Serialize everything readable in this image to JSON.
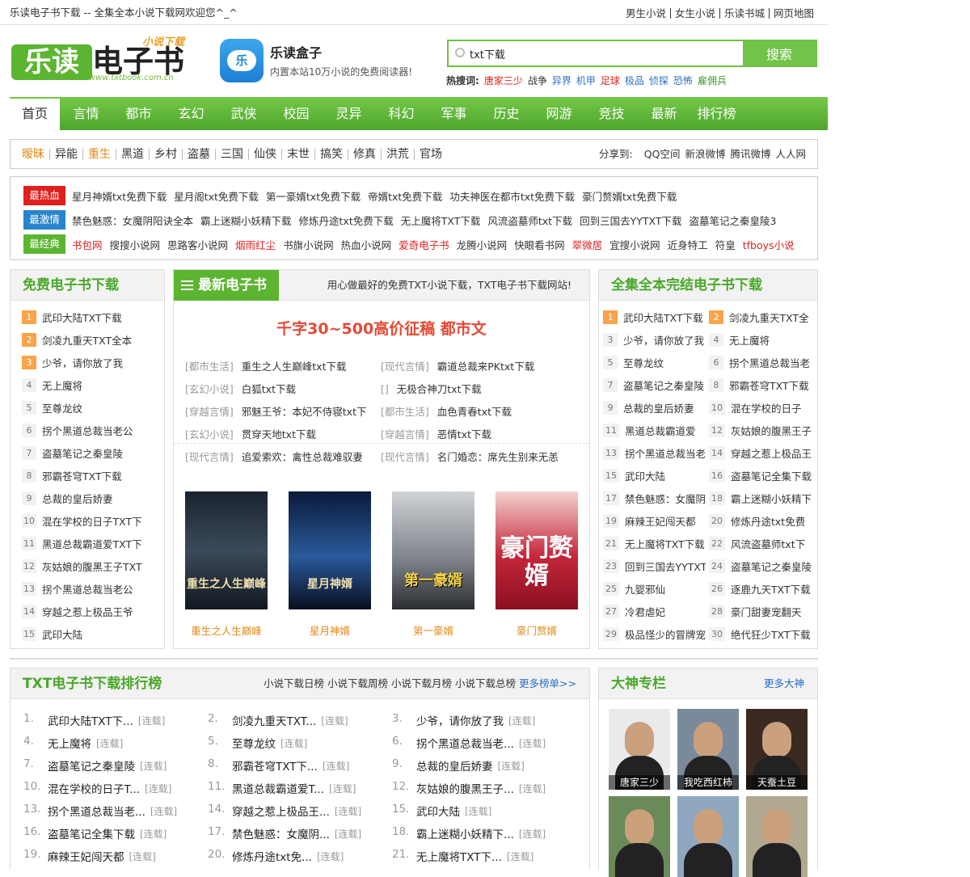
{
  "topbar": {
    "welcome": "乐读电子书下载 -- 全集全本小说下载网欢迎您^_^",
    "links": [
      "男生小说",
      "女生小说",
      "乐读书城",
      "网页地图"
    ]
  },
  "logo": {
    "main": "乐读",
    "main2": "电子书",
    "tag": "小说下载",
    "url": "www.txtbook.com.cn"
  },
  "app": {
    "icon_char": "乐",
    "name": "乐读盒子",
    "desc": "内置本站10万小说的免费阅读器!"
  },
  "search": {
    "value": "txt下载",
    "button": "搜索"
  },
  "hotwords": {
    "label": "热搜词:",
    "items": [
      {
        "text": "唐家三少",
        "color": "#e02020"
      },
      {
        "text": "战争",
        "color": "#333333"
      },
      {
        "text": "异界",
        "color": "#2a6ec7"
      },
      {
        "text": "机甲",
        "color": "#2a6ec7"
      },
      {
        "text": "足球",
        "color": "#e02020"
      },
      {
        "text": "极品",
        "color": "#2a6ec7"
      },
      {
        "text": "侦探",
        "color": "#2a6ec7"
      },
      {
        "text": "恐怖",
        "color": "#2a6ec7"
      },
      {
        "text": "雇佣兵",
        "color": "#3a9a2a"
      }
    ]
  },
  "nav": [
    "首页",
    "言情",
    "都市",
    "玄幻",
    "武侠",
    "校园",
    "灵异",
    "科幻",
    "军事",
    "历史",
    "网游",
    "竞技",
    "最新",
    "排行榜"
  ],
  "categories": [
    {
      "text": "暧昧",
      "color": "#e08a1a"
    },
    {
      "text": "异能",
      "color": "#333333"
    },
    {
      "text": "重生",
      "color": "#e08a1a"
    },
    {
      "text": "黑道",
      "color": "#333333"
    },
    {
      "text": "乡村",
      "color": "#333333"
    },
    {
      "text": "盗墓",
      "color": "#333333"
    },
    {
      "text": "三国",
      "color": "#333333"
    },
    {
      "text": "仙侠",
      "color": "#333333"
    },
    {
      "text": "末世",
      "color": "#333333"
    },
    {
      "text": "搞笑",
      "color": "#333333"
    },
    {
      "text": "修真",
      "color": "#333333"
    },
    {
      "text": "洪荒",
      "color": "#333333"
    },
    {
      "text": "官场",
      "color": "#333333"
    }
  ],
  "share": {
    "label": "分享到:",
    "items": [
      "QQ空间",
      "新浪微博",
      "腾讯微博",
      "人人网"
    ]
  },
  "hot_rows": [
    {
      "tag": "最热血",
      "color": "#e0201e",
      "links": [
        {
          "t": "星月神婿txt免费下载",
          "c": "#333"
        },
        {
          "t": "星月阁txt免费下载",
          "c": "#333"
        },
        {
          "t": "第一豪婿txt免费下载",
          "c": "#333"
        },
        {
          "t": "帝婿txt免费下载",
          "c": "#333"
        },
        {
          "t": "功夫神医在都市txt免费下载",
          "c": "#333"
        },
        {
          "t": "豪门赘婿txt免费下载",
          "c": "#333"
        }
      ]
    },
    {
      "tag": "最激情",
      "color": "#2a83cd",
      "links": [
        {
          "t": "禁色魅惑：女魔阴阳诀全本",
          "c": "#333"
        },
        {
          "t": "霸上迷糊小妖精下载",
          "c": "#333"
        },
        {
          "t": "修炼丹途txt免费下载",
          "c": "#333"
        },
        {
          "t": "无上魔将TXT下载",
          "c": "#333"
        },
        {
          "t": "风流盗墓师txt下载",
          "c": "#333"
        },
        {
          "t": "回到三国去YYTXT下载",
          "c": "#333"
        },
        {
          "t": "盗墓笔记之秦皇陵3",
          "c": "#333"
        }
      ]
    },
    {
      "tag": "最经典",
      "color": "#5cb531",
      "links": [
        {
          "t": "书包网",
          "c": "#e02020"
        },
        {
          "t": "搜搜小说网",
          "c": "#333"
        },
        {
          "t": "思路客小说网",
          "c": "#333"
        },
        {
          "t": "烟雨红尘",
          "c": "#e02020"
        },
        {
          "t": "书旗小说网",
          "c": "#333"
        },
        {
          "t": "热血小说网",
          "c": "#333"
        },
        {
          "t": "爱奇电子书",
          "c": "#e02020"
        },
        {
          "t": "龙腾小说网",
          "c": "#333"
        },
        {
          "t": "快眼看书网",
          "c": "#333"
        },
        {
          "t": "翠微居",
          "c": "#e02020"
        },
        {
          "t": "宜搜小说网",
          "c": "#333"
        },
        {
          "t": "近身特工",
          "c": "#333"
        },
        {
          "t": "符皇",
          "c": "#333"
        },
        {
          "t": "tfboys小说",
          "c": "#e02020"
        }
      ]
    }
  ],
  "free_box": {
    "title": "免费电子书下载",
    "items": [
      "武印大陆TXT下载",
      "剑凌九重天TXT全本",
      "少爷，请你放了我",
      "无上魔将",
      "至尊龙纹",
      "拐个黑道总裁当老公",
      "盗墓笔记之秦皇陵",
      "邪霸苍穹TXT下载",
      "总裁的皇后娇妻",
      "混在学校的日子TXT下",
      "黑道总裁霸道爱TXT下",
      "灰姑娘的腹黑王子TXT",
      "拐个黑道总裁当老公",
      "穿越之惹上极品王爷",
      "武印大陆"
    ]
  },
  "new_box": {
    "title": "最新电子书",
    "slogan": "用心做最好的免费TXT小说下载，TXT电子书下载网站!",
    "promo": "千字30~500高价征稿 都市文",
    "recs": [
      {
        "g": "[都市生活]",
        "t": "重生之人生巅峰txt下载"
      },
      {
        "g": "[现代言情]",
        "t": "霸道总裁来PKtxt下载"
      },
      {
        "g": "[玄幻小说]",
        "t": "白狐txt下载"
      },
      {
        "g": "[]",
        "t": "无极合神刀txt下载"
      },
      {
        "g": "[穿越言情]",
        "t": "邪魅王爷：本妃不侍寝txt下"
      },
      {
        "g": "[都市生活]",
        "t": "血色青春txt下载"
      },
      {
        "g": "[玄幻小说]",
        "t": "贯穿天地txt下载"
      },
      {
        "g": "[穿越言情]",
        "t": "恶情txt下载"
      },
      {
        "g": "[现代言情]",
        "t": "追爱索欢：禽性总裁难驭妻"
      },
      {
        "g": "[现代言情]",
        "t": "名门婚恋：席先生别来无恙"
      }
    ],
    "covers": [
      {
        "label": "重生之人生巅峰",
        "art": "重生之人生巅峰",
        "bg": "linear-gradient(#1b2430,#3b4a5a 50%,#121820)"
      },
      {
        "label": "星月神婿",
        "art": "星月神婿",
        "bg": "linear-gradient(#0a1a3a,#2a5a9a 55%,#0a0f1f)"
      },
      {
        "label": "第一豪婿",
        "art": "第一豪婿",
        "bg": "linear-gradient(#cfd3d6,#7a7f86 60%,#2a2d30)"
      },
      {
        "label": "豪门赘婿",
        "art": "豪门赘婿",
        "bg": "linear-gradient(#f3d2cf,#c4263a 55%,#8a1020)"
      }
    ]
  },
  "full_box": {
    "title": "全集全本完结电子书下载",
    "items": [
      "武印大陆TXT下载",
      "剑凌九重天TXT全",
      "少爷，请你放了我",
      "无上魔将",
      "至尊龙纹",
      "拐个黑道总裁当老",
      "盗墓笔记之秦皇陵",
      "邪霸苍穹TXT下载",
      "总裁的皇后娇妻",
      "混在学校的日子",
      "黑道总裁霸道爱",
      "灰姑娘的腹黑王子",
      "拐个黑道总裁当老",
      "穿越之惹上极品王",
      "武印大陆",
      "盗墓笔记全集下载",
      "禁色魅惑：女魔阴",
      "霸上迷糊小妖精下",
      "麻辣王妃闯天都",
      "修炼丹途txt免费",
      "无上魔将TXT下载",
      "风流盗墓师txt下",
      "回到三国去YYTXT",
      "盗墓笔记之秦皇陵",
      "九婴邪仙",
      "逐鹿九天TXT下载",
      "冷君虐妃",
      "豪门甜妻宠翻天",
      "极品怪少的冒牌宠",
      "绝代狂少TXT下载"
    ]
  },
  "rank_box": {
    "title": "TXT电子书下载排行榜",
    "tabs": [
      "小说下载日榜",
      "小说下载周榜",
      "小说下载月榜",
      "小说下载总榜"
    ],
    "more": "更多榜单>>",
    "status": "[连载]",
    "items": [
      {
        "n": "1.",
        "t": "武印大陆TXT下..."
      },
      {
        "n": "2.",
        "t": "剑凌九重天TXT..."
      },
      {
        "n": "3.",
        "t": "少爷，请你放了我"
      },
      {
        "n": "4.",
        "t": "无上魔将"
      },
      {
        "n": "5.",
        "t": "至尊龙纹"
      },
      {
        "n": "6.",
        "t": "拐个黑道总裁当老..."
      },
      {
        "n": "7.",
        "t": "盗墓笔记之秦皇陵"
      },
      {
        "n": "8.",
        "t": "邪霸苍穹TXT下..."
      },
      {
        "n": "9.",
        "t": "总裁的皇后娇妻"
      },
      {
        "n": "10.",
        "t": "混在学校的日子T..."
      },
      {
        "n": "11.",
        "t": "黑道总裁霸道爱T..."
      },
      {
        "n": "12.",
        "t": "灰姑娘的腹黑王子..."
      },
      {
        "n": "13.",
        "t": "拐个黑道总裁当老..."
      },
      {
        "n": "14.",
        "t": "穿越之惹上极品王..."
      },
      {
        "n": "15.",
        "t": "武印大陆"
      },
      {
        "n": "16.",
        "t": "盗墓笔记全集下载"
      },
      {
        "n": "17.",
        "t": "禁色魅惑：女魔阴..."
      },
      {
        "n": "18.",
        "t": "霸上迷糊小妖精下..."
      },
      {
        "n": "19.",
        "t": "麻辣王妃闯天都"
      },
      {
        "n": "20.",
        "t": "修炼丹途txt免..."
      },
      {
        "n": "21.",
        "t": "无上魔将TXT下..."
      }
    ]
  },
  "authors_box": {
    "title": "大神专栏",
    "more": "更多大神",
    "authors": [
      {
        "name": "唐家三少",
        "bg": "#eaeaea"
      },
      {
        "name": "我吃西红柿",
        "bg": "#7a8a9c"
      },
      {
        "name": "天蚕土豆",
        "bg": "#3a2a22"
      },
      {
        "name": "",
        "bg": "#6a8a5a"
      },
      {
        "name": "",
        "bg": "#8fa8c0"
      },
      {
        "name": "",
        "bg": "#b0a890"
      }
    ]
  },
  "colors": {
    "brand_green": "#5cb531",
    "accent_orange": "#f9a44a",
    "link_blue": "#2a6ec7"
  }
}
